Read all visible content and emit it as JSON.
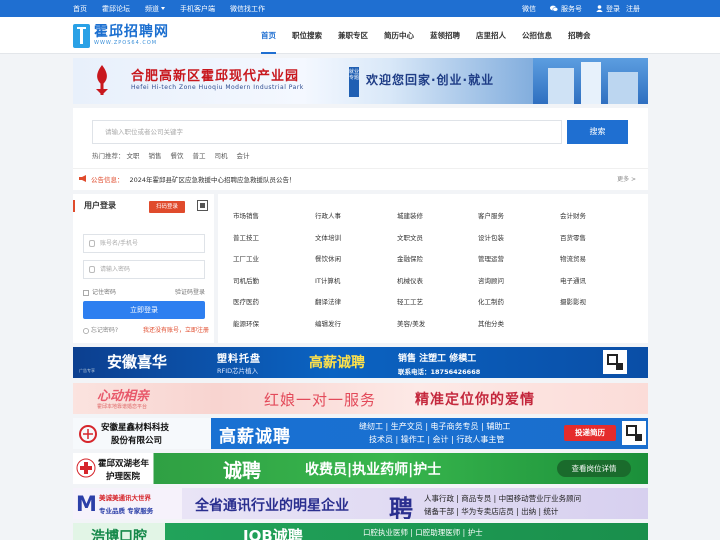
{
  "topbar": {
    "links": [
      "首页",
      "霍邱论坛",
      "频道",
      "手机客户端",
      "微信找工作"
    ],
    "wechat": "微信",
    "service": "服务号",
    "login": "登录",
    "register": "注册"
  },
  "logo": {
    "title": "霍邱招聘网",
    "subtitle": "WWW.ZPOS64.COM"
  },
  "nav": [
    "首页",
    "职位搜索",
    "兼职专区",
    "简历中心",
    "蓝领招聘",
    "店里招人",
    "公招信息",
    "招聘会"
  ],
  "top_banner": {
    "title": "合肥高新区霍邱现代产业园",
    "subtitle": "Hefei Hi-tech Zone Huoqiu Modern Industrial Park",
    "tag": "就业专题",
    "slogan": "欢迎您回家·创业·就业"
  },
  "search": {
    "placeholder": "请输入职位或者公司关键字",
    "button": "搜索",
    "hot_label": "热门推荐：",
    "hot_keywords": [
      "文职",
      "销售",
      "餐饮",
      "普工",
      "司机",
      "会计"
    ]
  },
  "notice": {
    "label": "公告信息：",
    "text": "2024年霍邱县矿区应急救援中心招聘应急救援队员公告！",
    "more": "更多 >"
  },
  "login": {
    "title": "用户登录",
    "qr_button": "扫码登录",
    "username_placeholder": "账号名/手机号",
    "password_placeholder": "请输入密码",
    "remember": "记住密码",
    "code_login": "验证码登录",
    "submit": "立即登录",
    "forgot": "忘记密码?",
    "register": "我还没有账号，立即注册"
  },
  "categories": [
    [
      "市场销售",
      "行政人事",
      "城建装修",
      "客户服务",
      "会计财务"
    ],
    [
      "普工技工",
      "文体培训",
      "文职文员",
      "设计包装",
      "百货零售"
    ],
    [
      "工厂工业",
      "餐饮休闲",
      "金融保险",
      "管理运营",
      "物流贸易"
    ],
    [
      "司机后勤",
      "IT计算机",
      "机械仪表",
      "咨询顾问",
      "电子通讯"
    ],
    [
      "医疗医药",
      "翻译法律",
      "轻工工艺",
      "化工制药",
      "摄影影视"
    ],
    [
      "能源环保",
      "编辑发行",
      "美容/美发",
      "其他分类",
      ""
    ]
  ],
  "ads": {
    "ad1": {
      "brand_tag": "广告专享",
      "brand": "安徽喜华",
      "product": "塑料托盘",
      "product_sub": "RFID芯片植入",
      "hiring": "高薪诚聘",
      "roles": "销售 注塑工 修模工",
      "phone": "联系电话：18756426668"
    },
    "ad2": {
      "brand": "心动相亲",
      "brand_sub": "霍邱本地靠谱婚恋平台",
      "slogan": "红娘一对一服务",
      "slogan2": "精准定位你的爱情"
    },
    "ad3": {
      "company": "安徽星鑫材料科技",
      "company2": "股份有限公司",
      "hiring": "高薪诚聘",
      "roles1": "缝纫工 | 生产文员 | 电子商务专员 | 辅助工",
      "roles2": "技术员 | 操作工 | 会计 | 行政人事主管",
      "button": "投递简历"
    },
    "ad4": {
      "hospital": "霍邱双湖老年",
      "hospital2": "护理医院",
      "hiring": "诚聘",
      "roles": "收费员|执业药师|护士",
      "button": "查看岗位详情"
    },
    "ad5": {
      "brand": "美诚美通讯大世界",
      "brand_sub": "专业品质  专家服务",
      "slogan": "全省通讯行业的明星企业",
      "hire_char": "聘",
      "roles1": "人事行政 | 商品专员 | 中国移动营业厅业务顾问",
      "roles2": "储备干部 | 华为专卖店店员 | 出纳 | 统计"
    },
    "ad6": {
      "brand": "浩博口腔",
      "hiring": "JOB诚聘",
      "roles": "口腔执业医师 | 口腔助理医师 | 护士"
    }
  }
}
